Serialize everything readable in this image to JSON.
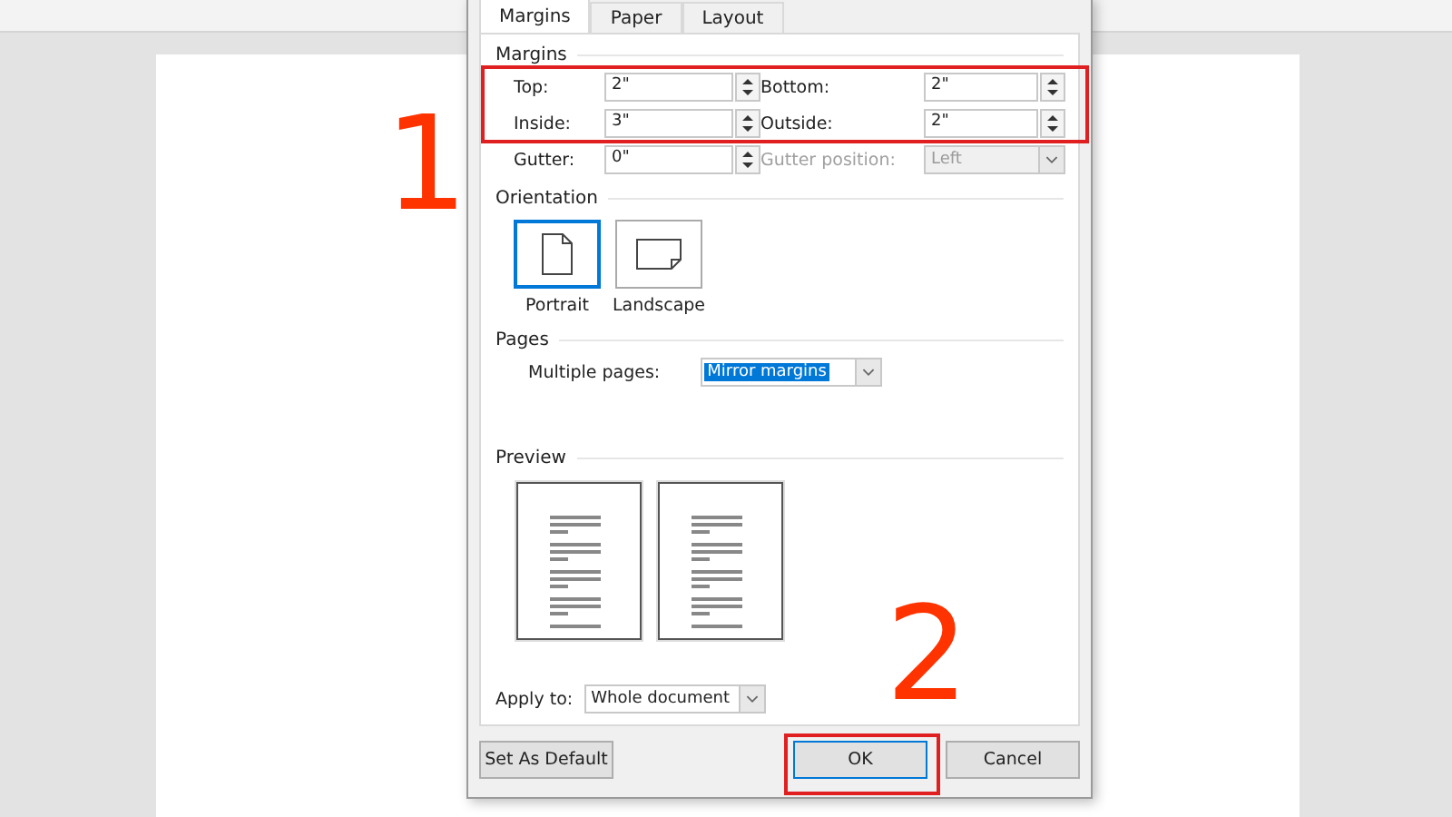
{
  "dialog": {
    "tabs": [
      {
        "label": "Margins",
        "selected": true
      },
      {
        "label": "Paper",
        "selected": false
      },
      {
        "label": "Layout",
        "selected": false
      }
    ],
    "margins": {
      "title": "Margins",
      "fields": [
        {
          "kind": "spinner",
          "label": "Top:",
          "value": "2\"",
          "disabled": false
        },
        {
          "kind": "spinner",
          "label": "Bottom:",
          "value": "2\"",
          "disabled": false
        },
        {
          "kind": "spinner",
          "label": "Inside:",
          "value": "3\"",
          "disabled": false
        },
        {
          "kind": "spinner",
          "label": "Outside:",
          "value": "2\"",
          "disabled": false
        },
        {
          "kind": "spinner",
          "label": "Gutter:",
          "value": "0\"",
          "disabled": false
        },
        {
          "kind": "dropdown",
          "label": "Gutter position:",
          "value": "Left",
          "disabled": true
        }
      ]
    },
    "orientation": {
      "title": "Orientation",
      "options": [
        {
          "kind": "portrait",
          "label": "Portrait",
          "selected": true
        },
        {
          "kind": "landscape",
          "label": "Landscape",
          "selected": false
        }
      ]
    },
    "pages": {
      "title": "Pages",
      "label": "Multiple pages:",
      "value": "Mirror margins"
    },
    "preview": {
      "title": "Preview"
    },
    "apply_to": {
      "label": "Apply to:",
      "value": "Whole document"
    },
    "buttons": [
      {
        "label": "Set As Default",
        "default": false
      },
      {
        "label": "OK",
        "default": true
      },
      {
        "label": "Cancel",
        "default": false
      }
    ]
  },
  "annotations": [
    {
      "label": "1"
    },
    {
      "label": "2"
    }
  ]
}
